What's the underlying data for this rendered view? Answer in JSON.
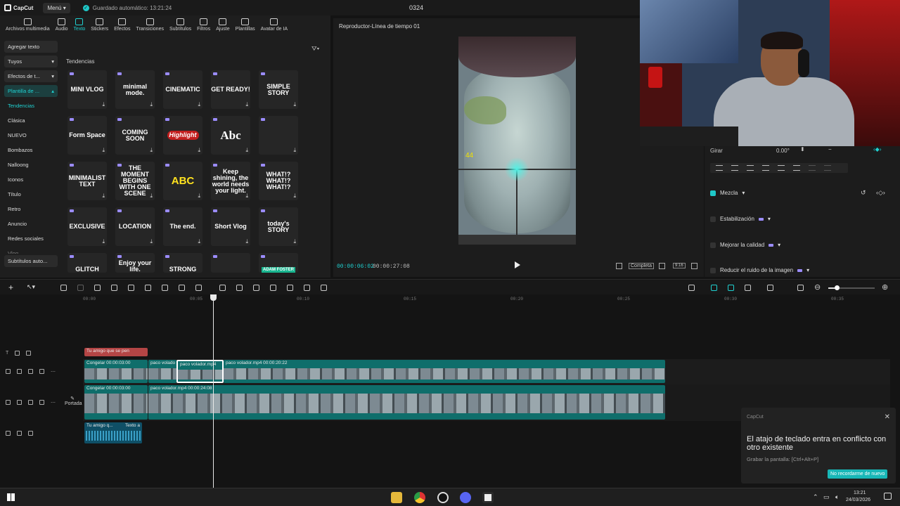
{
  "titlebar": {
    "app_name": "CapCut",
    "menu_label": "Menú",
    "autosave": "Guardado automático: 13:21:24",
    "project_title": "0324"
  },
  "tools": [
    {
      "label": "Archivos multimedia",
      "active": false
    },
    {
      "label": "Audio",
      "active": false
    },
    {
      "label": "Texto",
      "active": true
    },
    {
      "label": "Stickers",
      "active": false
    },
    {
      "label": "Efectos",
      "active": false
    },
    {
      "label": "Transiciones",
      "active": false
    },
    {
      "label": "Subtítulos",
      "active": false
    },
    {
      "label": "Filtros",
      "active": false
    },
    {
      "label": "Ajuste",
      "active": false
    },
    {
      "label": "Plantillas",
      "active": false
    },
    {
      "label": "Avatar de IA",
      "active": false
    }
  ],
  "sidebar": {
    "agregar_texto": "Agregar texto",
    "tuyos": "Tuyos",
    "efectos": "Efectos de t...",
    "plantilla": "Plantilla de ...",
    "subcats": [
      "Tendencias",
      "Clásica",
      "NUEVO",
      "Bombazos",
      "Nalloong",
      "Iconos",
      "Título",
      "Retro",
      "Anuncio",
      "Redes sociales",
      "Vlog"
    ],
    "subtitulos_auto": "Subtítulos auto..."
  },
  "templates_heading": "Tendencias",
  "templates": [
    {
      "text": "MINI VLOG",
      "style": ""
    },
    {
      "text": "minimal mode.",
      "style": ""
    },
    {
      "text": "CINEMATIC",
      "style": ""
    },
    {
      "text": "GET READY!",
      "style": ""
    },
    {
      "text": "SIMPLE STORY",
      "style": ""
    },
    {
      "text": "Form Space",
      "style": ""
    },
    {
      "text": "COMING SOON",
      "style": ""
    },
    {
      "text": "Highlight",
      "style": "hl"
    },
    {
      "text": "Abc",
      "style": "big"
    },
    {
      "text": "",
      "style": ""
    },
    {
      "text": "MINIMALIST TEXT",
      "style": ""
    },
    {
      "text": "THE MOMENT BEGINS WITH ONE SCENE",
      "style": ""
    },
    {
      "text": "ABC",
      "style": "ylw"
    },
    {
      "text": "Keep shining, the world needs your light.",
      "style": ""
    },
    {
      "text": "WHAT!? WHAT!? WHAT!?",
      "style": ""
    },
    {
      "text": "EXCLUSIVE",
      "style": ""
    },
    {
      "text": "LOCATION",
      "style": ""
    },
    {
      "text": "The end.",
      "style": ""
    },
    {
      "text": "Short Vlog",
      "style": ""
    },
    {
      "text": "today's STORY",
      "style": ""
    },
    {
      "text": "GLITCH",
      "style": ""
    },
    {
      "text": "Enjoy your life.",
      "style": ""
    },
    {
      "text": "STRONG",
      "style": ""
    },
    {
      "text": "",
      "style": ""
    },
    {
      "text": "ADAM FOSTER",
      "style": "adam"
    }
  ],
  "player": {
    "title": "Reproductor-Línea de tiempo 01",
    "fps": "44",
    "time_current": "00:00:06:02",
    "time_total": "00:00:27:08",
    "completa": "Completa",
    "ratio": "9:16"
  },
  "props": {
    "girar_label": "Girar",
    "girar_value": "0.00°",
    "mezcla": "Mezcla",
    "estabilizacion": "Estabilización",
    "mejorar": "Mejorar la calidad",
    "reducir": "Reducir el ruido de la imagen"
  },
  "ruler": [
    "00:00",
    "00:05",
    "00:10",
    "00:15",
    "00:20",
    "00:25",
    "00:30",
    "00:35"
  ],
  "tracks": {
    "text_clip": "Tu amigo que se pen",
    "v1_clips": [
      "Congelar  00:00:03:00",
      "paco volado",
      "paco volador.mp4",
      "paco volador.mp4  00:00:20:22"
    ],
    "main_clips": [
      "Congelar  00:00:03:00",
      "paco volador.mp4  00:00:24:08"
    ],
    "portada": "Portada",
    "audio_clips": [
      "Tu amigo q...",
      "Texto a"
    ]
  },
  "toast": {
    "app": "CapCut",
    "message": "El atajo de teclado entra en conflicto con otro existente",
    "sub": "Grabar la pantalla: [Ctrl+Alt+P]",
    "button": "No recordarme de nuevo"
  },
  "taskbar": {
    "time": "13:21",
    "date": "24/03/2026"
  }
}
